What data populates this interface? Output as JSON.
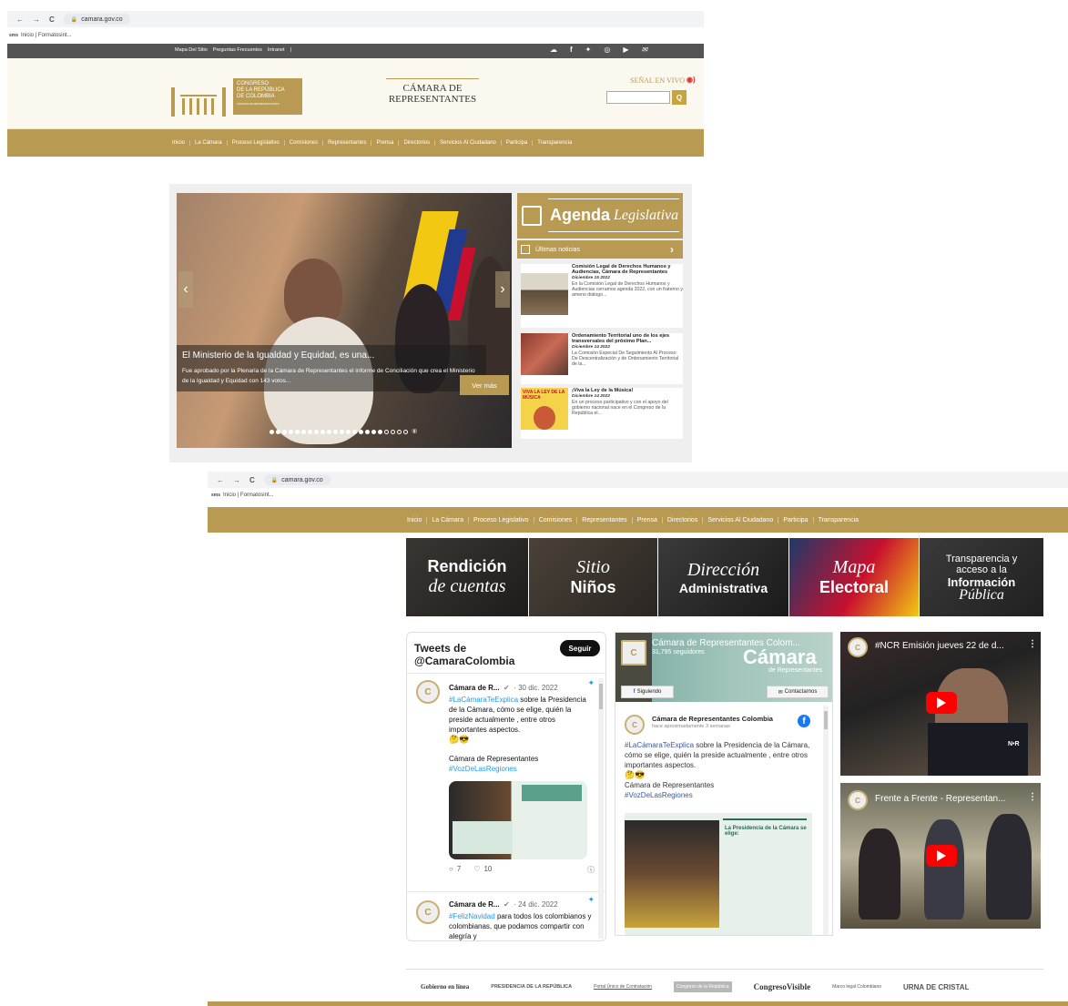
{
  "browser": {
    "back": "←",
    "forward": "→",
    "reload": "C",
    "lock": "🔒",
    "url": "camara.gov.co",
    "bookmark_icon": "sms",
    "bookmark_text": "Inicio | Formatosint..."
  },
  "topbar": {
    "links": [
      "Mapa Del Sitio",
      "Preguntas Frecuentes",
      "Intranet",
      "|"
    ],
    "social_icons": [
      "cloud-icon",
      "facebook-icon",
      "twitter-icon",
      "instagram-icon",
      "youtube-icon",
      "flickr-icon"
    ]
  },
  "header": {
    "congreso_logo_text": "CONGRESO",
    "congreso_line2": "DE LA REPÚBLICA",
    "congreso_line3": "DE COLOMBIA",
    "congreso_line4": "CÁMARA DE REPRESENTANTES",
    "camara_title_1": "CÁMARA DE",
    "camara_title_2": "REPRESENTANTES",
    "senal_label": "SEÑAL EN VIVO",
    "search_button": "Q"
  },
  "nav": {
    "items": [
      "Inicio",
      "La Cámara",
      "Proceso Legislativo",
      "Comisiones",
      "Representantes",
      "Prensa",
      "Directorios",
      "Servicios Al Ciudadano",
      "Participa",
      "Transparencia"
    ]
  },
  "slider": {
    "title": "El Ministerio de la Igualdad y Equidad, es una...",
    "text": "Fue aprobado por la Plenaria de la Cámara de Representantes el informe de Conciliación que crea el Ministerio de la Igualdad y Equidad con 143 votos...",
    "button": "Ver más",
    "prev": "‹",
    "next": "›",
    "filled_dots": 18,
    "empty_dots": 4,
    "end_glyph": "⑧"
  },
  "agenda": {
    "title_bold": "Agenda",
    "title_script": "Legislativa",
    "ultimas": "Últimas noticias",
    "ultimas_arrow": "›"
  },
  "news": [
    {
      "title": "Comisión Legal de Derechos Humanos y Audiencias, Cámara de Representantes",
      "date": "Diciembre 15 2022",
      "excerpt": "En la Comisión Legal de Derechos Humanos y Audiencias cerramos agenda 2022, con un fraterno y ameno diálogo..."
    },
    {
      "title": "Ordenamiento Territorial uno de los ejes transversales del próximo Plan...",
      "date": "Diciembre 14 2022",
      "excerpt": "La Comisión Especial De Seguimiento Al Proceso De Descentralización y de Ordenamiento Territorial de la..."
    },
    {
      "title": "¡Viva la Ley de la Música!",
      "date": "Diciembre 14 2022",
      "excerpt": "En un proceso participativo y con el apoyo del gobierno nacional nace en el Congreso de la República el..."
    }
  ],
  "thumb3_text": "VIVA LA LEY DE LA MÚSICA",
  "browser2": {
    "back": "←",
    "forward": "→",
    "reload": "C",
    "lock": "🔒",
    "url": "camara.gov.co",
    "bookmark_icon": "sms",
    "bookmark_text": "Inicio | Formatosint..."
  },
  "nav2": {
    "items": [
      "Inicio",
      "La Cámara",
      "Proceso Legislativo",
      "Comisiones",
      "Representantes",
      "Prensa",
      "Directorios",
      "Servicios Al Ciudadano",
      "Participa",
      "Transparencia"
    ]
  },
  "tiles": {
    "t1_a": "Rendición",
    "t1_b": "de cuentas",
    "t2_a": "Sitio",
    "t2_b": "Niños",
    "t3_a": "Dirección",
    "t3_b": "Administrativa",
    "t4_a": "Mapa",
    "t4_b": "Electoral",
    "t5_a": "Transparencia y",
    "t5_b": "acceso a la",
    "t5_c": "Información",
    "t5_d": "Pública"
  },
  "twitter": {
    "heading_1": "Tweets de",
    "heading_2": "@CamaraColombia",
    "follow": "Seguir",
    "avatar": "C",
    "tweet1_name": "Cámara de R...",
    "tweet1_meta": "· 30 dic. 2022",
    "tweet1_hash": "#LaCámaraTeExplica",
    "tweet1_text": "sobre la Presidencia de la Cámara, cómo se elige, quién la preside actualmente , entre otros importantes aspectos.",
    "tweet1_emoji": "🤔😎",
    "tweet1_sig": "Cámara de Representantes",
    "tweet1_hash2": "#VozDeLasRegiones",
    "tweet1_replies": "7",
    "tweet1_likes": "10",
    "tweet2_name": "Cámara de R...",
    "tweet2_meta": "· 24 dic. 2022",
    "tweet2_hash": "#FelizNavidad",
    "tweet2_text": "para todos los colombianos y colombianas, que podamos compartir con alegría y"
  },
  "facebook": {
    "page_name": "Cámara de Representantes Colom...",
    "followers": "31,795 seguidores",
    "cover_title": "Cámara",
    "cover_sub": "de Representantes",
    "following": "Siguiendo",
    "contact": "Contactarnos",
    "post_name": "Cámara de Representantes Colombia",
    "post_time": "hace aproximadamente 3 semanas",
    "post_hash": "#LaCámaraTeExplica",
    "post_text": "sobre la Presidencia de la Cámara, cómo se elige, quién la preside actualmente , entre otros importantes aspectos.",
    "post_emoji": "🤔😎",
    "post_sig": "Cámara de Representantes",
    "post_hash2": "#VozDeLasRegiones",
    "img_title": "La Presidencia de la Cámara se elige:"
  },
  "youtube": [
    {
      "title": "#NCR Emisión jueves 22 de d..."
    },
    {
      "title": "Frente a Frente - Representan..."
    }
  ],
  "youtube_watermark": "N•R",
  "footer": {
    "logos": [
      "Gobierno en línea",
      "PRESIDENCIA DE LA REPÚBLICA",
      "Portal Único de Contratación",
      "Congreso de la República",
      "CongresoVisible",
      "Marco legal Colombiano",
      "URNA DE CRISTAL"
    ]
  }
}
